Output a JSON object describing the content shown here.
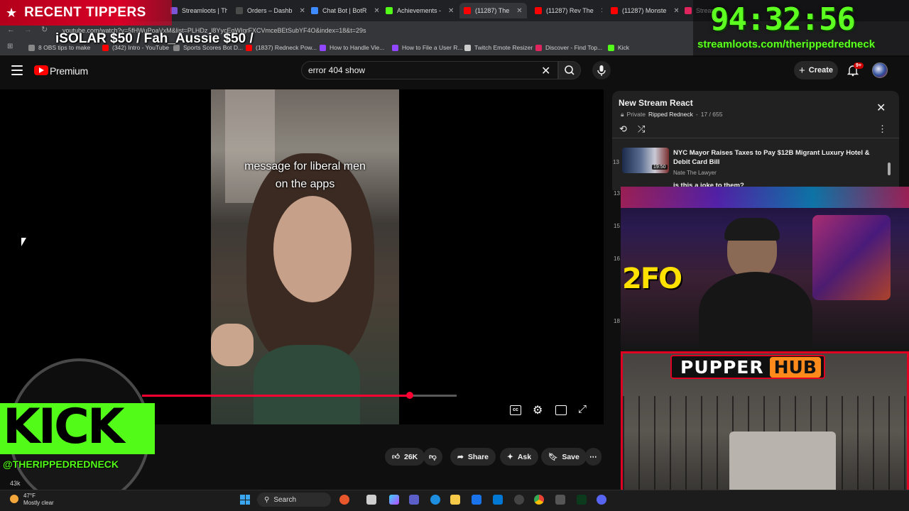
{
  "browser": {
    "tabs": [
      {
        "label": "Streamloots | Th",
        "color": "#7a55d6"
      },
      {
        "label": "Orders – Dashb",
        "color": "#4a4a4a"
      },
      {
        "label": "Chat Bot | BotR",
        "color": "#3d8bfd"
      },
      {
        "label": "Achievements -",
        "color": "#53fc18"
      },
      {
        "label": "(11287) The",
        "color": "#ff0000"
      },
      {
        "label": "(11287) Rev The",
        "color": "#ff0000"
      },
      {
        "label": "(11287) Monste",
        "color": "#ff0000"
      },
      {
        "label": "Stream",
        "color": "#e0245e"
      }
    ],
    "url": "youtube.com/watch?v=5fHWuPoaVxM&list=PLHDz_l8YycEqWIgrFXCVmceBEtSubYF4O&index=18&t=29s",
    "bookmarks": [
      {
        "label": "8 OBS tips to make",
        "color": "#888"
      },
      {
        "label": "(342) Intro - YouTube",
        "color": "#ff0000"
      },
      {
        "label": "Sports Scores Bot D...",
        "color": "#888"
      },
      {
        "label": "(1837) Redneck Pow...",
        "color": "#ff0000"
      },
      {
        "label": "How to Handle Vie...",
        "color": "#9147ff"
      },
      {
        "label": "How to File a User R...",
        "color": "#9147ff"
      },
      {
        "label": "Twitch Emote Resizer",
        "color": "#cccccc"
      },
      {
        "label": "Discover - Find Top...",
        "color": "#e0245e"
      },
      {
        "label": "Kick",
        "color": "#53fc18"
      }
    ]
  },
  "overlay": {
    "tippers_title": "RECENT TIPPERS",
    "tippers_list": "iSOLAR $50 / Fah_Aussie $50 /",
    "timer": "94:32:56",
    "timer_url": "streamloots.com/therippedredneck",
    "kick_logo_text": "KICK",
    "kick_handle": "@THERIPPEDREDNECK",
    "webcam_sign_text": "2FO",
    "pupper_label": "PUPPER",
    "hub_label": "HUB"
  },
  "youtube": {
    "brand": "Premium",
    "search_value": "error 404 show",
    "create_label": "Create",
    "notification_count": "9+",
    "video_caption_line1": "message for liberal men",
    "video_caption_line2": "on the apps",
    "progress": 0.85,
    "views_partial": "43k",
    "actions": {
      "like_count": "26K",
      "share": "Share",
      "ask": "Ask",
      "save": "Save"
    },
    "playlist": {
      "title": "New Stream React",
      "privacy": "Private",
      "owner": "Ripped Redneck",
      "position": "17 / 655",
      "visible_indices": [
        "13",
        "15",
        "16",
        "18"
      ],
      "current": {
        "index": "13",
        "title": "NYC Mayor Raises Taxes to Pay $12B Migrant Luxury Hotel & Debit Card Bill",
        "channel": "Nate The Lawyer",
        "duration": "19:50"
      },
      "next_title": "is this a joke to them?"
    }
  },
  "taskbar": {
    "weather_temp": "47°F",
    "weather_desc": "Mostly clear",
    "search_label": "Search"
  }
}
